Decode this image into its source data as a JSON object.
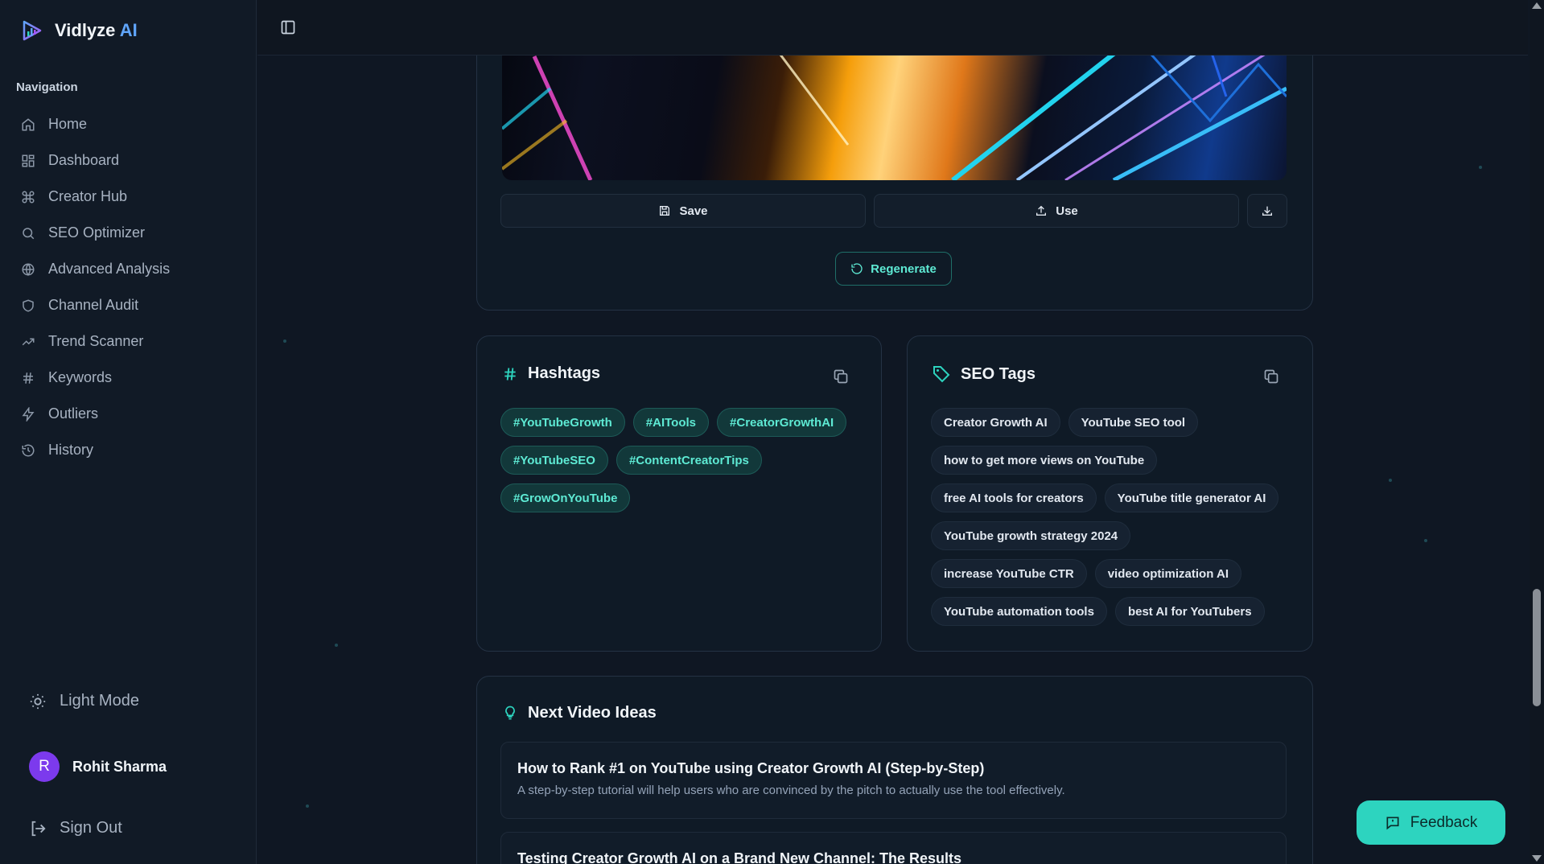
{
  "brand": {
    "name": "Vidlyze",
    "accent": "AI"
  },
  "sidebar": {
    "heading": "Navigation",
    "items": [
      {
        "label": "Home",
        "icon": "home-icon"
      },
      {
        "label": "Dashboard",
        "icon": "dashboard-icon"
      },
      {
        "label": "Creator Hub",
        "icon": "command-icon"
      },
      {
        "label": "SEO Optimizer",
        "icon": "search-icon"
      },
      {
        "label": "Advanced Analysis",
        "icon": "globe-icon"
      },
      {
        "label": "Channel Audit",
        "icon": "shield-icon"
      },
      {
        "label": "Trend Scanner",
        "icon": "trending-up-icon"
      },
      {
        "label": "Keywords",
        "icon": "hash-icon"
      },
      {
        "label": "Outliers",
        "icon": "lightning-icon"
      },
      {
        "label": "History",
        "icon": "history-icon"
      }
    ],
    "light_mode": "Light Mode",
    "user": {
      "initial": "R",
      "name": "Rohit Sharma"
    },
    "sign_out": "Sign Out"
  },
  "thumbnail_actions": {
    "save": "Save",
    "use": "Use",
    "regenerate": "Regenerate"
  },
  "hashtags": {
    "title": "Hashtags",
    "items": [
      "#YouTubeGrowth",
      "#AITools",
      "#CreatorGrowthAI",
      "#YouTubeSEO",
      "#ContentCreatorTips",
      "#GrowOnYouTube"
    ]
  },
  "seo_tags": {
    "title": "SEO Tags",
    "items": [
      "Creator Growth AI",
      "YouTube SEO tool",
      "how to get more views on YouTube",
      "free AI tools for creators",
      "YouTube title generator AI",
      "YouTube growth strategy 2024",
      "increase YouTube CTR",
      "video optimization AI",
      "YouTube automation tools",
      "best AI for YouTubers"
    ]
  },
  "next_video_ideas": {
    "title": "Next Video Ideas",
    "items": [
      {
        "title": "How to Rank #1 on YouTube using Creator Growth AI (Step-by-Step)",
        "description": "A step-by-step tutorial will help users who are convinced by the pitch to actually use the tool effectively."
      },
      {
        "title": "Testing Creator Growth AI on a Brand New Channel: The Results",
        "description": ""
      }
    ]
  },
  "feedback": "Feedback",
  "colors": {
    "accent_teal": "#2dd4bf",
    "brand_blue": "#60a5fa",
    "background": "#0f1723"
  }
}
